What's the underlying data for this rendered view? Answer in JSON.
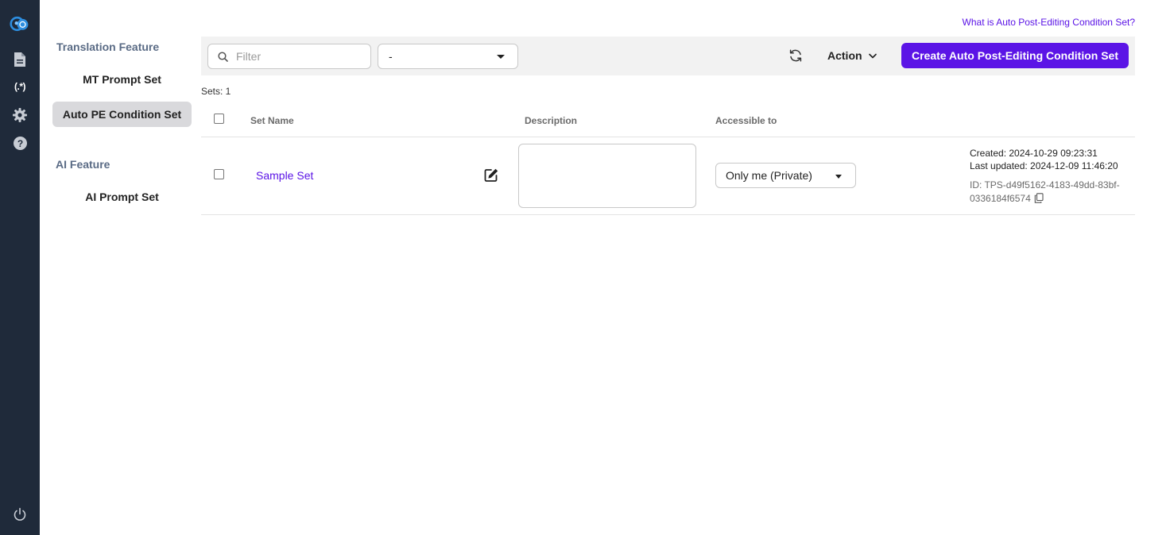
{
  "help_link": "What is Auto Post-Editing Condition Set?",
  "nav": {
    "translation_feature": "Translation Feature",
    "mt_prompt_set": "MT Prompt Set",
    "auto_pe_condition_set": "Auto PE Condition Set",
    "ai_feature": "AI Feature",
    "ai_prompt_set": "AI Prompt Set"
  },
  "rail_icons": [
    "logo-icon",
    "document-icon",
    "regex-icon",
    "gear-icon",
    "help-icon",
    "power-icon"
  ],
  "rail_regex_label": "(.*)",
  "toolbar": {
    "filter_placeholder": "Filter",
    "select_value": "-",
    "action_label": "Action",
    "create_label": "Create Auto Post-Editing Condition Set"
  },
  "sets_count": "Sets: 1",
  "table": {
    "headers": {
      "set_name": "Set Name",
      "description": "Description",
      "accessible_to": "Accessible to"
    },
    "rows": [
      {
        "name": "Sample Set",
        "description": "",
        "accessible_to": "Only me (Private)",
        "created": "Created: 2024-10-29 09:23:31",
        "updated": "Last updated: 2024-12-09 11:46:20",
        "id_line1": "ID: TPS-d49f5162-4183-49dd-83bf-",
        "id_line2": "0336184f6574"
      }
    ]
  },
  "colors": {
    "accent": "#5b14e6",
    "rail": "#1f2a3a",
    "toolbar_bg": "#f2f2f2",
    "active_nav": "#d9d9dc"
  }
}
